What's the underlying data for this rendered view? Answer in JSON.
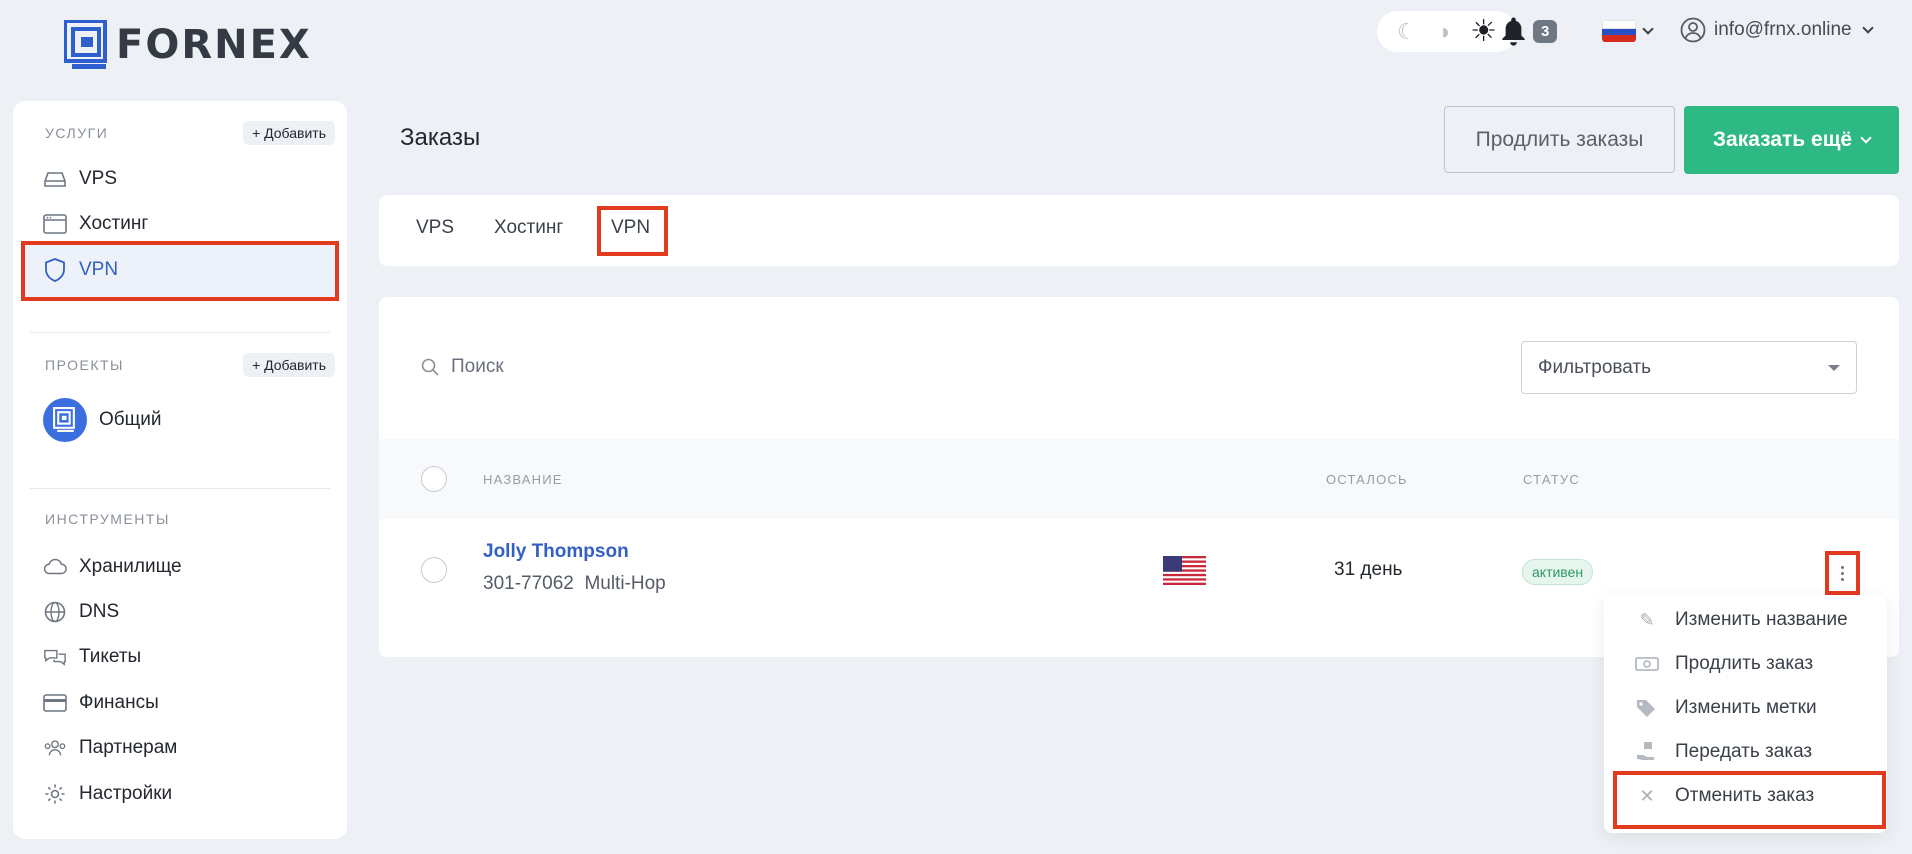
{
  "brand": {
    "name": "FORNEX"
  },
  "header": {
    "notifications_count": "3",
    "user_email": "info@frnx.online"
  },
  "sidebar": {
    "services_title": "Услуги",
    "add_label": "+ Добавить",
    "services": [
      {
        "label": "VPS",
        "icon": "server-icon"
      },
      {
        "label": "Хостинг",
        "icon": "browser-window-icon"
      },
      {
        "label": "VPN",
        "icon": "shield-icon",
        "active": true
      }
    ],
    "projects_title": "Проекты",
    "projects_add_label": "+ Добавить",
    "projects": [
      {
        "label": "Общий",
        "icon": "project-logo-icon"
      }
    ],
    "tools_title": "Инструменты",
    "tools": [
      {
        "label": "Хранилище",
        "icon": "cloud-icon"
      },
      {
        "label": "DNS",
        "icon": "globe-icon"
      },
      {
        "label": "Тикеты",
        "icon": "chat-bubbles-icon"
      },
      {
        "label": "Финансы",
        "icon": "credit-card-icon"
      },
      {
        "label": "Партнерам",
        "icon": "people-icon"
      },
      {
        "label": "Настройки",
        "icon": "gear-icon"
      }
    ]
  },
  "main": {
    "title": "Заказы",
    "renew_button": "Продлить заказы",
    "order_button": "Заказать ещё",
    "tabs": [
      {
        "label": "VPS"
      },
      {
        "label": "Хостинг"
      },
      {
        "label": "VPN",
        "active": true
      }
    ],
    "search_placeholder": "Поиск",
    "filter_placeholder": "Фильтровать",
    "columns": {
      "name": "Название",
      "left": "Осталось",
      "status": "Статус"
    },
    "rows": [
      {
        "name": "Jolly Thompson",
        "id": "301-77062",
        "type": "Multi-Hop",
        "country_flag": "us-flag-icon",
        "time_left": "31 день",
        "status": "активен"
      }
    ]
  },
  "row_menu": {
    "items": [
      {
        "label": "Изменить название",
        "icon": "edit-icon"
      },
      {
        "label": "Продлить заказ",
        "icon": "money-icon"
      },
      {
        "label": "Изменить метки",
        "icon": "tags-icon"
      },
      {
        "label": "Передать заказ",
        "icon": "hand-transfer-icon"
      },
      {
        "label": "Отменить заказ",
        "icon": "close-icon"
      }
    ]
  },
  "colors": {
    "accent_blue": "#3461c1",
    "primary_green": "#2db884",
    "highlight_red": "#e23a1f",
    "status_green": "#2c9a65"
  }
}
